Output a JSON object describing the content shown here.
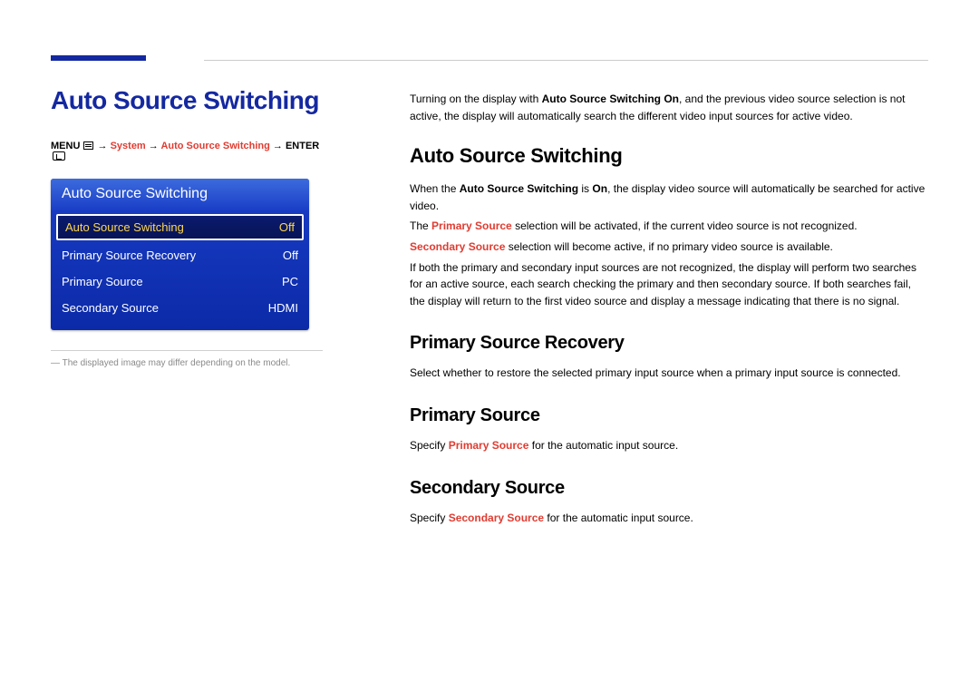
{
  "left": {
    "title": "Auto Source Switching",
    "breadcrumb": {
      "menu": "MENU",
      "arrow": "→",
      "system": "System",
      "item": "Auto Source Switching",
      "enter": "ENTER"
    },
    "osd": {
      "header": "Auto Source Switching",
      "rows": [
        {
          "label": "Auto Source Switching",
          "value": "Off",
          "selected": true
        },
        {
          "label": "Primary Source Recovery",
          "value": "Off",
          "selected": false
        },
        {
          "label": "Primary Source",
          "value": "PC",
          "selected": false
        },
        {
          "label": "Secondary Source",
          "value": "HDMI",
          "selected": false
        }
      ]
    },
    "footnote": "The displayed image may differ depending on the model."
  },
  "right": {
    "intro_pre": "Turning on the display with ",
    "intro_bold": "Auto Source Switching On",
    "intro_post": ", and the previous video source selection is not active, the display will automatically search the different video input sources for active video.",
    "h_ass": "Auto Source Switching",
    "ass_p1_pre": "When the ",
    "ass_p1_bold": "Auto Source Switching",
    "ass_p1_mid": " is ",
    "ass_p1_bold2": "On",
    "ass_p1_post": ", the display video source will automatically be searched for active video.",
    "ass_p2_pre": "The ",
    "ass_p2_red": "Primary Source",
    "ass_p2_post": " selection will be activated, if the current video source is not recognized.",
    "ass_p3_red": "Secondary Source",
    "ass_p3_post": " selection will become active, if no primary video source is available.",
    "ass_p4": "If both the primary and secondary input sources are not recognized, the display will perform two searches for an active source, each search checking the primary and then secondary source. If both searches fail, the display will return to the first video source and display a message indicating that there is no signal.",
    "h_psr": "Primary Source Recovery",
    "psr_p": "Select whether to restore the selected primary input source when a primary input source is connected.",
    "h_ps": "Primary Source",
    "ps_p_pre": "Specify ",
    "ps_p_red": "Primary Source",
    "ps_p_post": " for the automatic input source.",
    "h_ss": "Secondary Source",
    "ss_p_pre": "Specify ",
    "ss_p_red": "Secondary Source",
    "ss_p_post": " for the automatic input source."
  }
}
